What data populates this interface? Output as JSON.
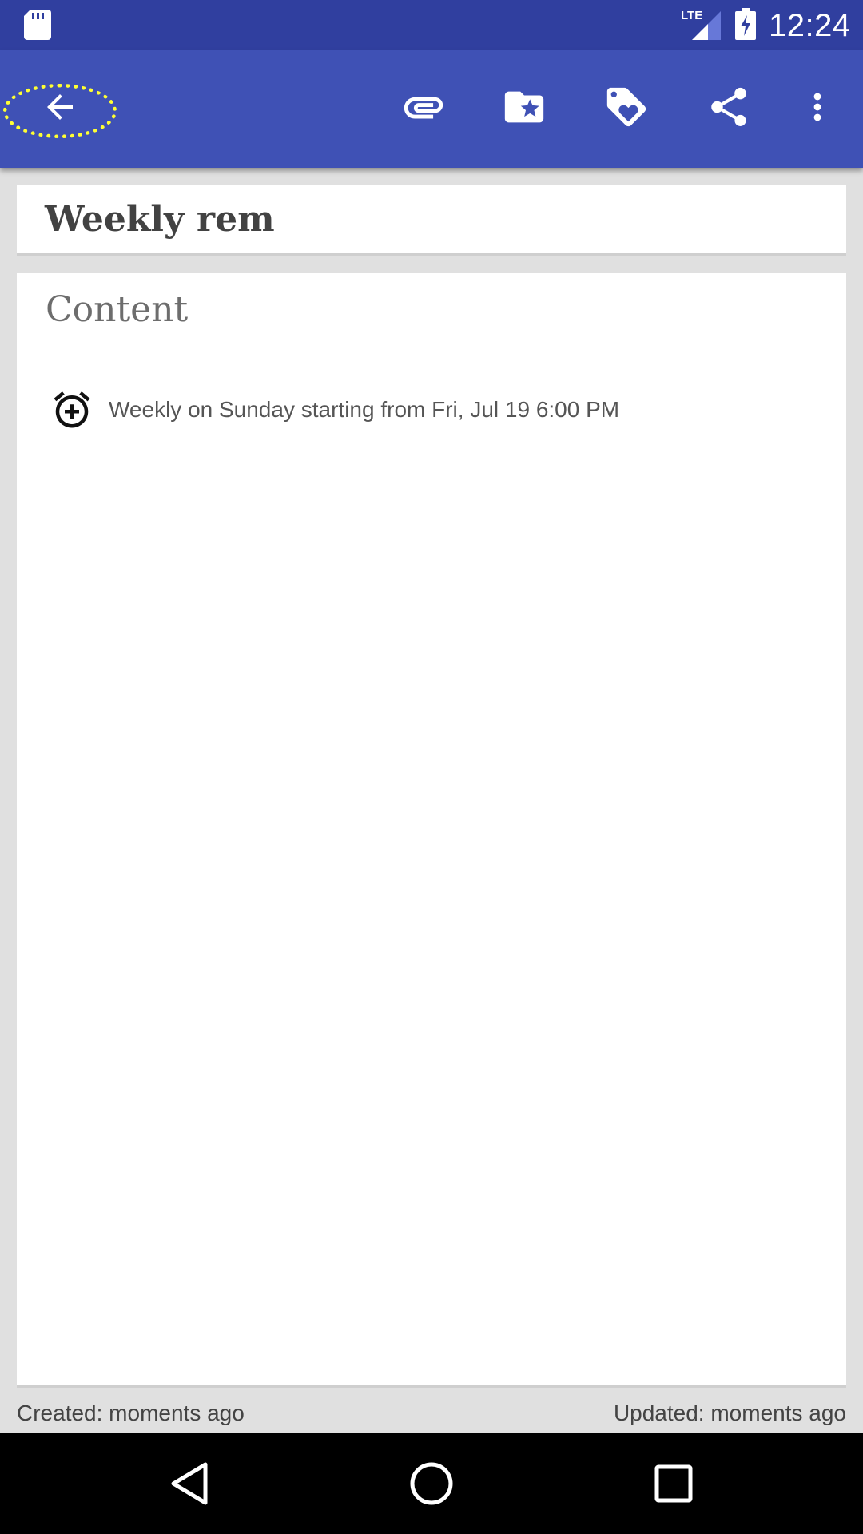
{
  "status_bar": {
    "time": "12:24",
    "network_label": "LTE",
    "icons": [
      "sd-card-icon",
      "lte-signal-icon",
      "battery-charging-icon"
    ]
  },
  "toolbar": {
    "icons": [
      "back-arrow-icon",
      "attachment-icon",
      "folder-star-icon",
      "tag-heart-icon",
      "share-icon",
      "more-vert-icon"
    ],
    "accent_color": "#3f51b5",
    "status_color": "#303f9f",
    "highlight_color": "#ffff33"
  },
  "note": {
    "title": "Weekly rem",
    "content_heading": "Content",
    "reminder_text": "Weekly on Sunday starting from Fri, Jul 19 6:00 PM"
  },
  "footer": {
    "created": "Created: moments ago",
    "updated": "Updated: moments ago"
  },
  "nav_bar": {
    "icons": [
      "back-triangle-icon",
      "home-circle-icon",
      "recents-square-icon"
    ]
  }
}
